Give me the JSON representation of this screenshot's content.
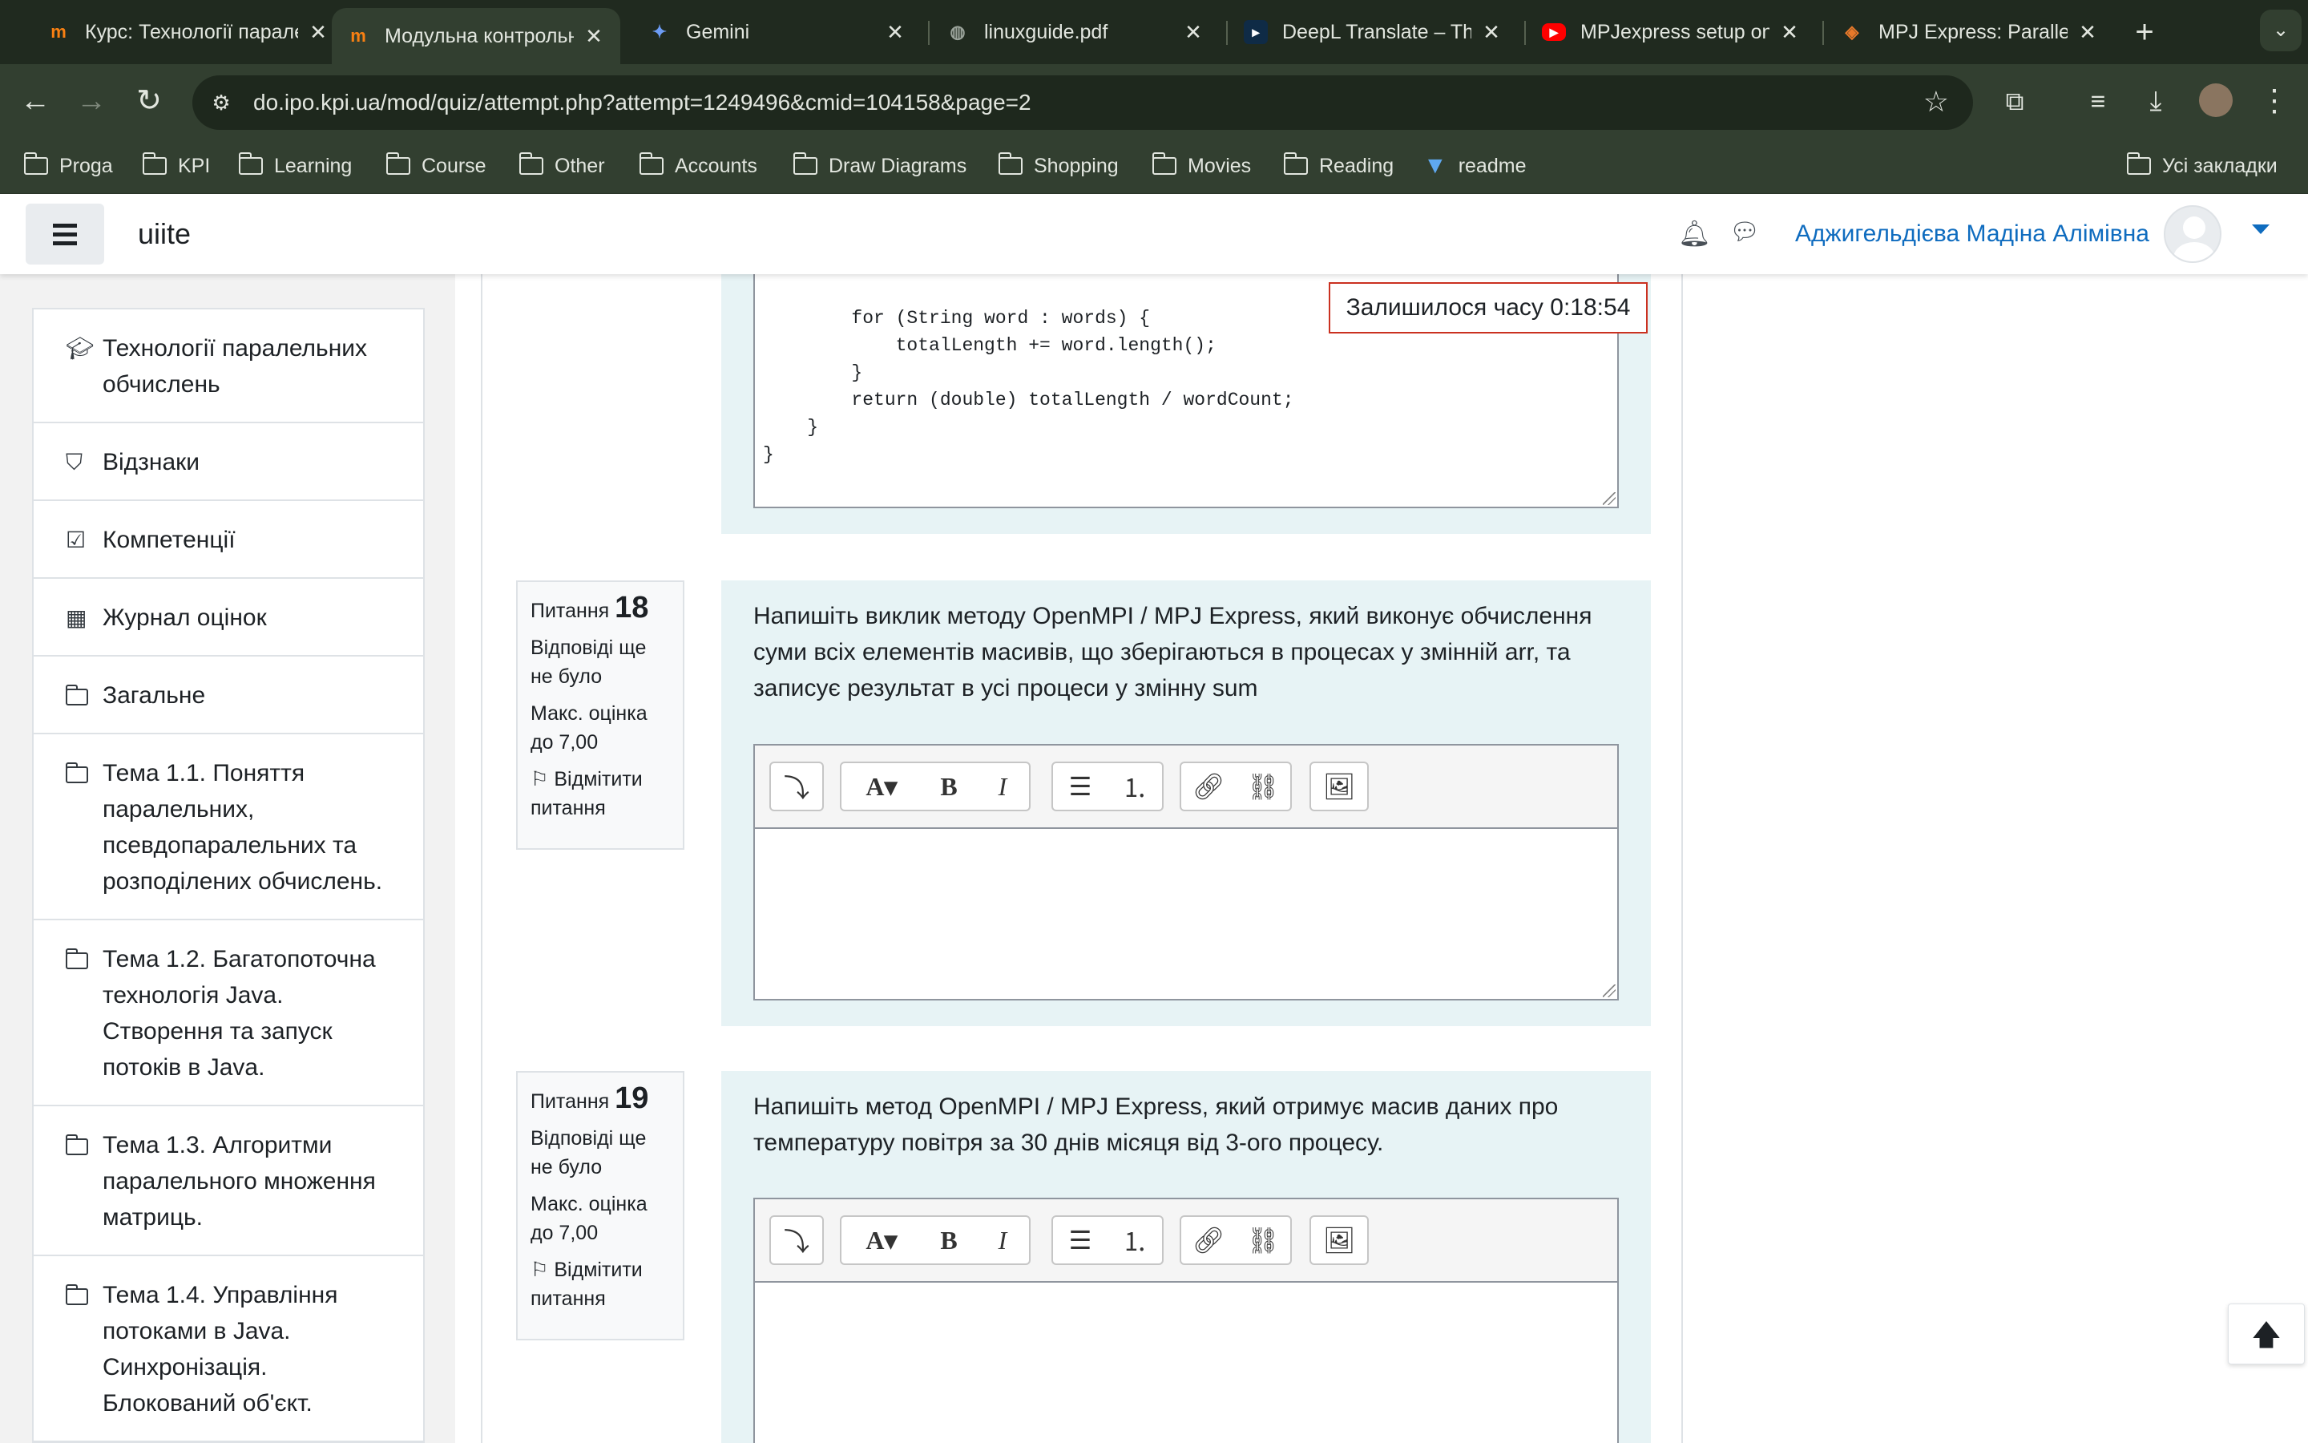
{
  "browser": {
    "tabs": [
      {
        "title": "Курс: Технології паралельних",
        "favicon": "moodle-icon"
      },
      {
        "title": "Модульна контрольна",
        "favicon": "moodle-icon",
        "active": true
      },
      {
        "title": "Gemini",
        "favicon": "gemini-icon"
      },
      {
        "title": "linuxguide.pdf",
        "favicon": "globe-icon"
      },
      {
        "title": "DeepL Translate – The world's most accurate",
        "favicon": "deepl-icon"
      },
      {
        "title": "MPJexpress setup on Windows",
        "favicon": "youtube-icon"
      },
      {
        "title": "MPJ Express: Parallel",
        "favicon": "mpj-icon"
      }
    ],
    "url": "do.ipo.kpi.ua/mod/quiz/attempt.php?attempt=1249496&cmid=104158&page=2",
    "bookmarks": [
      "Proga",
      "KPI",
      "Learning",
      "Course",
      "Other",
      "Accounts",
      "Draw Diagrams",
      "Shopping",
      "Movies",
      "Reading",
      "readme"
    ],
    "all_bookmarks": "Усі закладки"
  },
  "site": {
    "name": "uiite",
    "user_name": "Аджигельдієва Мадіна Алімівна"
  },
  "drawer": {
    "items": [
      {
        "icon": "graduation-cap-icon",
        "label": "Технології паралельних обчислень"
      },
      {
        "icon": "shield-icon",
        "label": "Відзнаки"
      },
      {
        "icon": "checkbox-icon",
        "label": "Компетенції"
      },
      {
        "icon": "table-icon",
        "label": "Журнал оцінок"
      },
      {
        "icon": "folder-icon",
        "label": "Загальне"
      },
      {
        "icon": "folder-icon",
        "label": "Тема 1.1. Поняття паралельних, псевдопаралельних та розподілених обчислень."
      },
      {
        "icon": "folder-icon",
        "label": "Тема 1.2. Багатопоточна технологія Java. Створення та запуск потоків в Java."
      },
      {
        "icon": "folder-icon",
        "label": "Тема 1.3. Алгоритми паралельного множення матриць."
      },
      {
        "icon": "folder-icon",
        "label": "Тема 1.4. Управління потоками в Java. Синхронізація. Блокований об'єкт."
      }
    ]
  },
  "timer": {
    "label": "Залишилося часу",
    "value": "0:18:54"
  },
  "prev_answer_code": "        for (String word : words) {\n            totalLength += word.length();\n        }\n        return (double) totalLength / wordCount;\n    }\n}",
  "questions": [
    {
      "prefix": "Питання",
      "number": "18",
      "status": "Відповіді ще не було",
      "max_grade": "Макс. оцінка до 7,00",
      "flag_label": "Відмітити питання",
      "text": "Напишіть виклик методу OpenMPI / MPJ Express, який виконує обчислення суми всіх елементів масивів, що зберігаються в процесах у змінній arr, та записує результат в усі процеси у змінну sum"
    },
    {
      "prefix": "Питання",
      "number": "19",
      "status": "Відповіді ще не було",
      "max_grade": "Макс. оцінка до 7,00",
      "flag_label": "Відмітити питання",
      "text": "Напишіть метод OpenMPI / MPJ Express, який отримує масив даних про температуру повітря за 30 днів місяця від 3-ого процесу."
    }
  ],
  "colors": {
    "chrome_dark": "#202a1f",
    "chrome_toolbar": "#323f30",
    "link_blue": "#0f6cbf",
    "question_bg": "#e7f3f5",
    "timer_border": "#ca3120"
  }
}
